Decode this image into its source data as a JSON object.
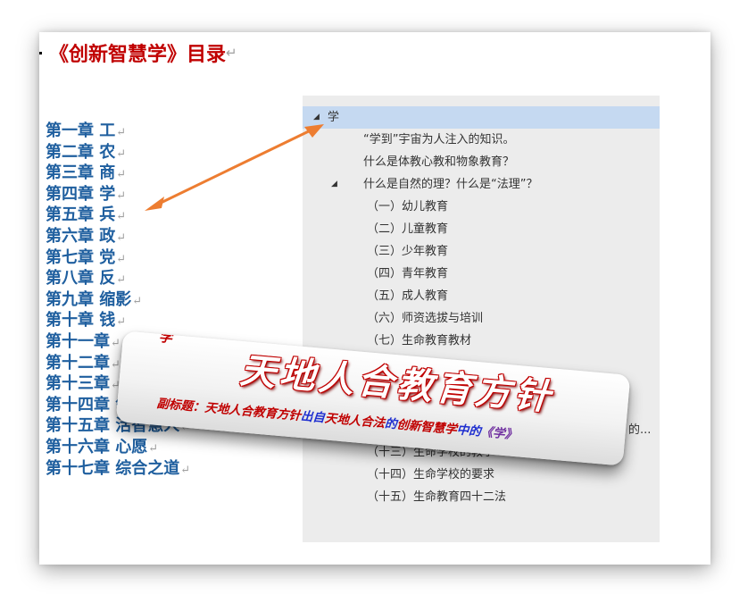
{
  "doc_title": "《创新智慧学》目录",
  "return_mark": "↵",
  "chapters": [
    "第一章 工",
    "第二章 农",
    "第三章 商",
    "第四章 学",
    "第五章 兵",
    "第六章 政",
    "第七章 党",
    "第八章 反",
    "第九章 缩影",
    "第十章 钱",
    "第十一章",
    "第十二章",
    "第十三章",
    "第十四章 领袖",
    "第十五章 活智慧人",
    "第十六章 心愿",
    "第十七章 综合之道"
  ],
  "nav_pane": {
    "root": "学",
    "items": [
      "“学到”宇宙为人注入的知识。",
      "什么是体教心教和物象教育？",
      "什么是自然的理？什么是“法理”？",
      "（一）幼儿教育",
      "（二）儿童教育",
      "（三）少年教育",
      "（四）青年教育",
      "（五）成人教育",
      "（六）师资选拔与培训",
      "（七）生命教育教材",
      "",
      "",
      "",
      "的...",
      "（十三）生命学校的教学",
      "（十四）生命学校的要求",
      "（十五）生命教育四十二法"
    ]
  },
  "banner": {
    "heading": "学",
    "main_title": "天地人合教育方针",
    "subtitle": {
      "label": "副标题：",
      "part1": "天地人合教育方针",
      "part2": "出自",
      "part3": "天地人合法",
      "part4": "的",
      "part5": "创新智慧学",
      "part6": "中的",
      "part7": "《学》"
    }
  },
  "colors": {
    "chapter": "#1f5f9f",
    "title": "#c00000",
    "arrow": "#ed7d31",
    "selection": "#c5d9f1"
  }
}
